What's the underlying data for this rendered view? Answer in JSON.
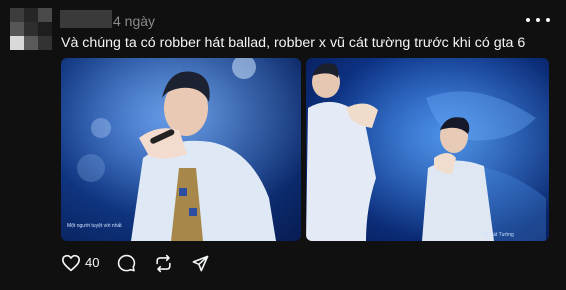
{
  "post": {
    "timestamp": "4 ngày",
    "caption": "Và chúng ta có robber hát ballad, robber x vũ cát tường trước khi có gta 6",
    "media": [
      {
        "watermark": "Một người tuyệt vời nhất"
      },
      {
        "watermark": "Vũ Cát Tường"
      }
    ],
    "actions": {
      "like_count": "40"
    }
  },
  "icons": {
    "like": "heart-icon",
    "comment": "comment-icon",
    "repost": "repost-icon",
    "share": "send-icon",
    "more": "more-icon"
  }
}
